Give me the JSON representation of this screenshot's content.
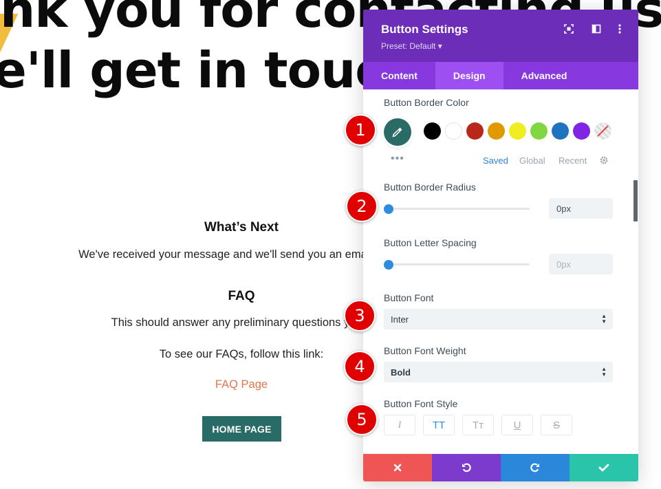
{
  "page": {
    "hero_line1": "nk you for contacting us",
    "hero_line2": "e'll get in touch",
    "whats_next_heading": "What’s Next",
    "whats_next_text": "We've received your message and we'll send you an email within",
    "faq_heading": "FAQ",
    "faq_text": "This should answer any preliminary questions you h",
    "faq_follow_text": "To see our FAQs, follow this link:",
    "faq_link_label": "FAQ Page",
    "home_button_label": "HOME PAGE",
    "colors": {
      "link": "#e0764c",
      "button": "#296b67"
    }
  },
  "panel": {
    "title": "Button Settings",
    "preset": "Preset: Default ▾",
    "tabs": [
      {
        "label": "Content",
        "active": false
      },
      {
        "label": "Design",
        "active": true
      },
      {
        "label": "Advanced",
        "active": false
      }
    ],
    "border_color": {
      "label": "Button Border Color",
      "selected": "#2b6b66",
      "swatches": [
        "#000000",
        "#ffffff",
        "#b8271a",
        "#e09900",
        "#eeee22",
        "#81d742",
        "#1e73be",
        "#8224e3",
        "transparent"
      ],
      "more": "•••",
      "tabs": [
        {
          "label": "Saved",
          "active": true
        },
        {
          "label": "Global",
          "active": false
        },
        {
          "label": "Recent",
          "active": false
        }
      ]
    },
    "border_radius": {
      "label": "Button Border Radius",
      "value": "0px",
      "slider_level": 0
    },
    "letter_spacing": {
      "label": "Button Letter Spacing",
      "placeholder": "0px",
      "slider_level": 0
    },
    "font": {
      "label": "Button Font",
      "value": "Inter"
    },
    "font_weight": {
      "label": "Button Font Weight",
      "value": "Bold"
    },
    "font_style": {
      "label": "Button Font Style",
      "options": [
        {
          "glyph": "I",
          "name": "italic",
          "active": false
        },
        {
          "glyph": "TT",
          "name": "uppercase",
          "active": true
        },
        {
          "glyph": "Tт",
          "name": "capitalize",
          "active": false
        },
        {
          "glyph": "U",
          "name": "underline",
          "active": false
        },
        {
          "glyph": "S",
          "name": "strikethrough",
          "active": false
        }
      ]
    },
    "footer_icons": [
      "close-icon",
      "undo-icon",
      "redo-icon",
      "check-icon"
    ],
    "accent": "#6c2eb9"
  },
  "markers": [
    "1",
    "2",
    "3",
    "4",
    "5"
  ]
}
